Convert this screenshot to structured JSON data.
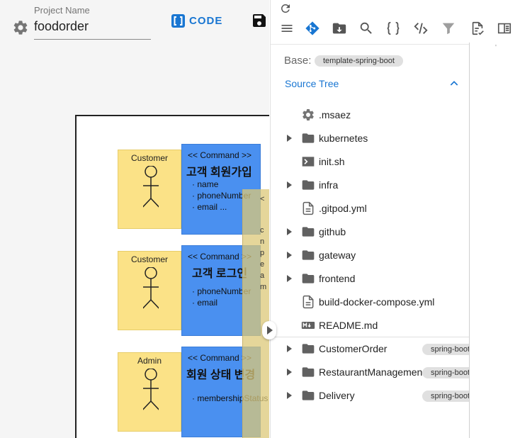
{
  "project": {
    "label": "Project Name",
    "value": "foodorder"
  },
  "toolbar_left": {
    "code_label": "CODE"
  },
  "board": {
    "actors": [
      {
        "label": "Customer"
      },
      {
        "label": "Customer"
      },
      {
        "label": "Admin"
      }
    ],
    "commands": [
      {
        "stereotype": "<< Command >>",
        "name": "고객 회원가입",
        "fields": [
          "name",
          "phoneNumber",
          "email ..."
        ]
      },
      {
        "stereotype": "<< Command >>",
        "name": "고객 로그인",
        "fields": [
          "phoneNumber",
          "email"
        ]
      },
      {
        "stereotype": "<< Command >>",
        "name": "회원 상태 변경",
        "fields": [
          "membershipStatus"
        ]
      }
    ],
    "overlay_chars": [
      "<",
      "c",
      "n",
      "p",
      "e",
      "a",
      "m"
    ]
  },
  "panel": {
    "base_label": "Base:",
    "base_chip": "template-spring-boot",
    "section_title": "Source Tree",
    "tree": [
      {
        "label": ".msaez",
        "icon": "gear-icon",
        "expandable": false
      },
      {
        "label": "kubernetes",
        "icon": "folder-icon",
        "expandable": true
      },
      {
        "label": "init.sh",
        "icon": "terminal-icon",
        "expandable": false
      },
      {
        "label": "infra",
        "icon": "folder-icon",
        "expandable": true
      },
      {
        "label": ".gitpod.yml",
        "icon": "file-icon",
        "expandable": false
      },
      {
        "label": "github",
        "icon": "folder-icon",
        "expandable": true
      },
      {
        "label": "gateway",
        "icon": "folder-icon",
        "expandable": true
      },
      {
        "label": "frontend",
        "icon": "folder-icon",
        "expandable": true
      },
      {
        "label": "build-docker-compose.yml",
        "icon": "file-icon",
        "expandable": false
      },
      {
        "label": "README.md",
        "icon": "markdown-icon",
        "expandable": false
      },
      {
        "label": "CustomerOrder",
        "icon": "folder-icon",
        "expandable": true,
        "chip": "spring-boot"
      },
      {
        "label": "RestaurantManagement",
        "icon": "folder-icon",
        "expandable": true,
        "chip": "spring-boot"
      },
      {
        "label": "Delivery",
        "icon": "folder-icon",
        "expandable": true,
        "chip": "spring-boot"
      }
    ]
  }
}
